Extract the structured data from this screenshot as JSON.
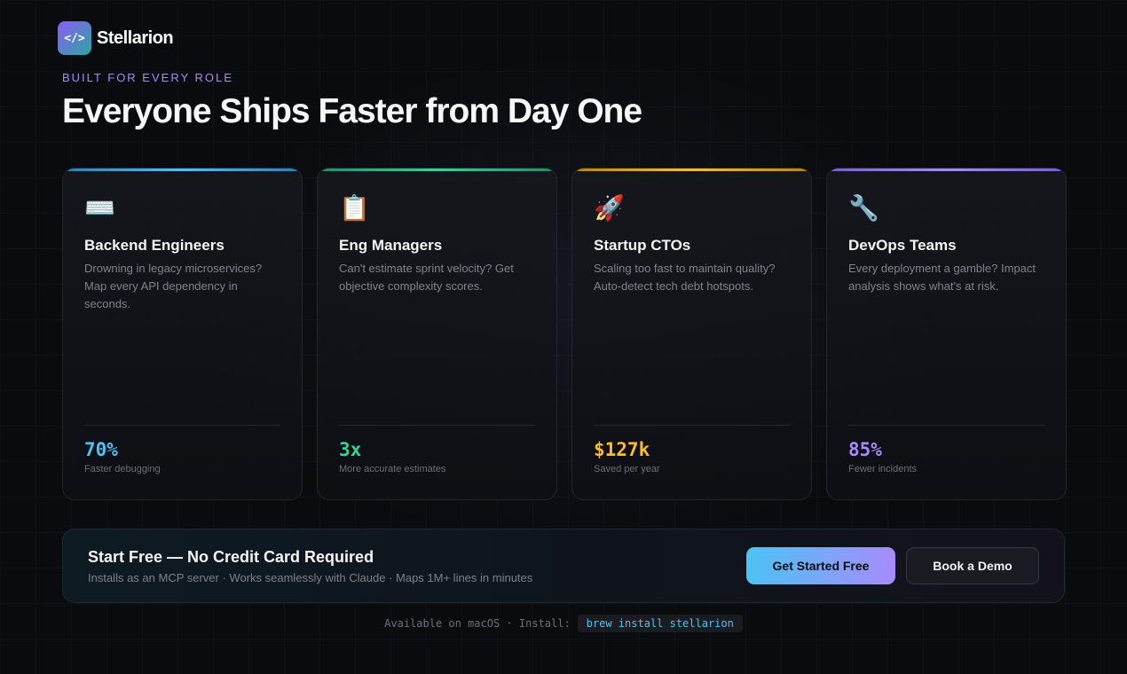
{
  "brand": {
    "logo_glyph": "</>",
    "name": "Stellarion"
  },
  "hero": {
    "eyebrow": "BUILT FOR EVERY ROLE",
    "headline": "Everyone Ships Faster from Day One"
  },
  "cards": [
    {
      "icon": "keyboard-icon",
      "emoji": "⌨️",
      "title": "Backend Engineers",
      "description": "Drowning in legacy microservices? Map every API dependency in seconds.",
      "stat": "70%",
      "stat_label": "Faster debugging",
      "accent": "#4cc3f5"
    },
    {
      "icon": "clipboard-icon",
      "emoji": "📋",
      "title": "Eng Managers",
      "description": "Can't estimate sprint velocity? Get objective complexity scores.",
      "stat": "3x",
      "stat_label": "More accurate estimates",
      "accent": "#34d399"
    },
    {
      "icon": "rocket-icon",
      "emoji": "🚀",
      "title": "Startup CTOs",
      "description": "Scaling too fast to maintain quality? Auto-detect tech debt hotspots.",
      "stat": "$127k",
      "stat_label": "Saved per year",
      "accent": "#fbbf24"
    },
    {
      "icon": "wrench-icon",
      "emoji": "🔧",
      "title": "DevOps Teams",
      "description": "Every deployment a gamble? Impact analysis shows what's at risk.",
      "stat": "85%",
      "stat_label": "Fewer incidents",
      "accent": "#a78bfa"
    }
  ],
  "cta": {
    "title": "Start Free — No Credit Card Required",
    "subtitle": "Installs as an MCP server · Works seamlessly with Claude · Maps 1M+ lines in minutes",
    "primary_label": "Get Started Free",
    "secondary_label": "Book a Demo"
  },
  "footer": {
    "text": "Available on macOS · Install:",
    "command": "brew install stellarion"
  }
}
